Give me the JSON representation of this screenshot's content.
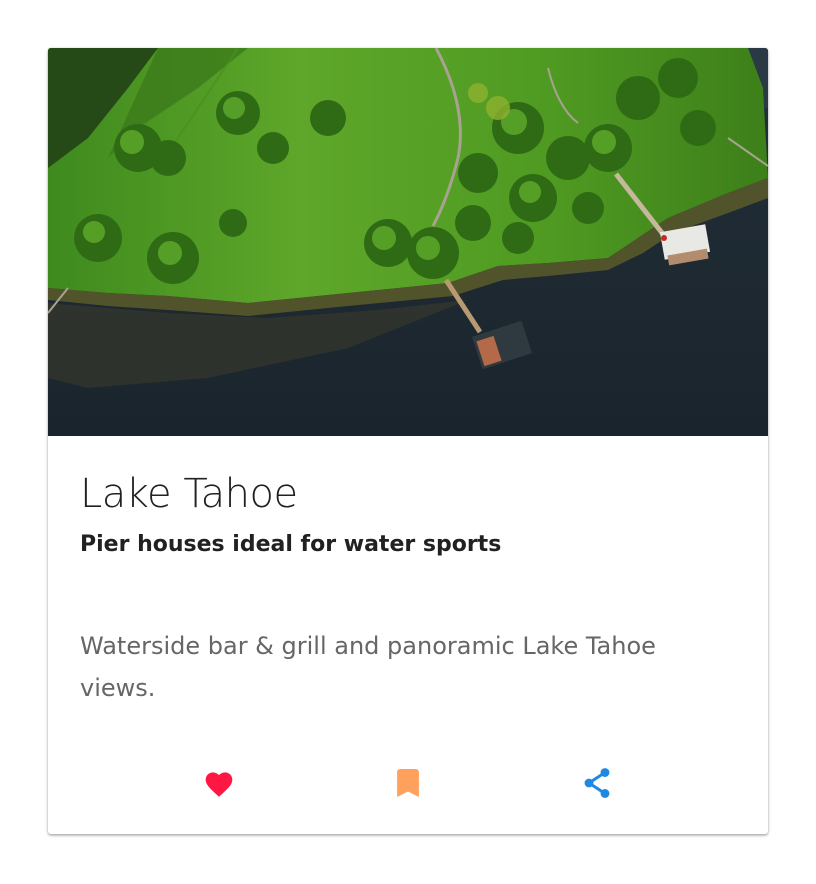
{
  "card": {
    "title": "Lake Tahoe",
    "subtitle": "Pier houses ideal for water sports",
    "description": "Waterside bar & grill and panoramic Lake Tahoe views.",
    "image": {
      "subject": "aerial photo of a green lakeside lawn with trees and two pier houses on dark water"
    }
  },
  "actions": [
    {
      "icon": "heart-icon",
      "color": "#ff1744"
    },
    {
      "icon": "bookmark-icon",
      "color": "#ffa15c"
    },
    {
      "icon": "share-icon",
      "color": "#1e88e5"
    }
  ]
}
